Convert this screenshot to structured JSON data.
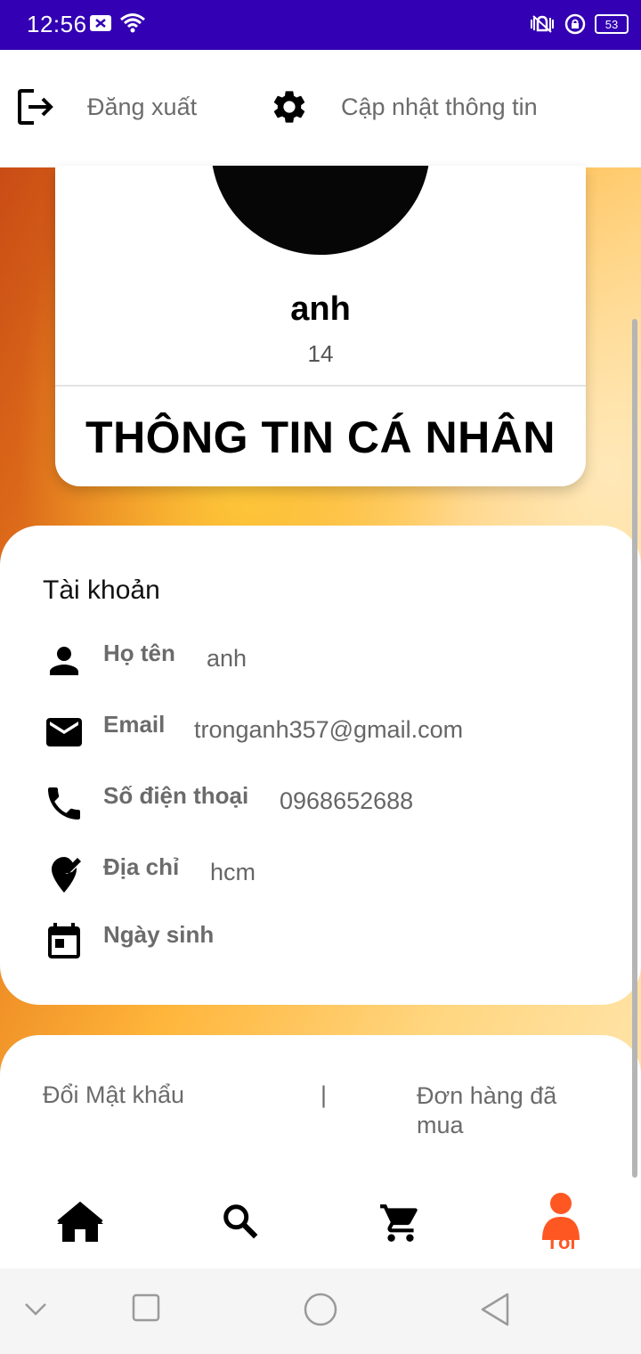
{
  "status_bar": {
    "time": "12:56",
    "battery": "53",
    "background_color": "#3300b3"
  },
  "topbar": {
    "logout_label": "Đăng xuất",
    "logout_icon": "logout-icon",
    "update_label": "Cập nhật thông tin",
    "update_icon": "gear-icon"
  },
  "profile": {
    "name": "anh",
    "age": "14",
    "title": "THÔNG TIN CÁ NHÂN"
  },
  "account": {
    "heading": "Tài khoản",
    "fields": [
      {
        "icon": "person-icon",
        "label": "Họ tên",
        "value": "anh"
      },
      {
        "icon": "email-icon",
        "label": "Email",
        "value": "tronganh357@gmail.com"
      },
      {
        "icon": "phone-icon",
        "label": "Số điện thoại",
        "value": "0968652688"
      },
      {
        "icon": "location-edit-icon",
        "label": "Địa chỉ",
        "value": "hcm"
      },
      {
        "icon": "calendar-icon",
        "label": "Ngày sinh",
        "value": ""
      }
    ]
  },
  "actions": {
    "change_password": "Đổi Mật khẩu",
    "separator": "|",
    "orders": "Đơn hàng đã mua"
  },
  "bottom_nav": {
    "items": [
      {
        "icon": "home-icon",
        "label": ""
      },
      {
        "icon": "search-icon",
        "label": ""
      },
      {
        "icon": "cart-icon",
        "label": ""
      },
      {
        "icon": "person-icon",
        "label": "Tôi"
      }
    ],
    "active_color": "#ff5722"
  }
}
